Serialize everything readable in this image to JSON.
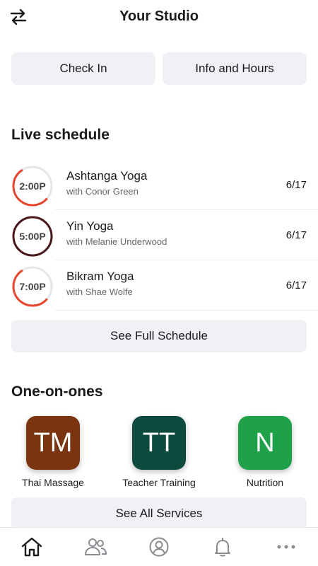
{
  "header": {
    "title": "Your Studio",
    "swap_icon": "swap-arrows-icon"
  },
  "actions": {
    "check_in": "Check In",
    "info_hours": "Info and Hours"
  },
  "live_schedule": {
    "title": "Live schedule",
    "classes": [
      {
        "time": "2:00P",
        "name": "Ashtanga Yoga",
        "teacher": "with Conor Green",
        "date": "6/17",
        "ring_fraction": 0.55,
        "ring_color": "#e8462f"
      },
      {
        "time": "5:00P",
        "name": "Yin Yoga",
        "teacher": "with Melanie Underwood",
        "date": "6/17",
        "ring_fraction": 1.0,
        "ring_color": "#4a1818"
      },
      {
        "time": "7:00P",
        "name": "Bikram Yoga",
        "teacher": "with Shae Wolfe",
        "date": "6/17",
        "ring_fraction": 0.55,
        "ring_color": "#e8462f"
      }
    ],
    "see_full": "See Full Schedule"
  },
  "one_on_ones": {
    "title": "One-on-ones",
    "services": [
      {
        "initials": "TM",
        "label": "Thai Massage",
        "color": "#7a3510"
      },
      {
        "initials": "TT",
        "label": "Teacher Training",
        "color": "#0f4a3e"
      },
      {
        "initials": "N",
        "label": "Nutrition",
        "color": "#1fa14a"
      }
    ],
    "see_all": "See All Services"
  },
  "tabbar": {
    "tabs": [
      {
        "icon": "home-icon",
        "active": true
      },
      {
        "icon": "people-icon",
        "active": false
      },
      {
        "icon": "profile-icon",
        "active": false
      },
      {
        "icon": "bell-icon",
        "active": false
      },
      {
        "icon": "more-icon",
        "active": false
      }
    ]
  }
}
